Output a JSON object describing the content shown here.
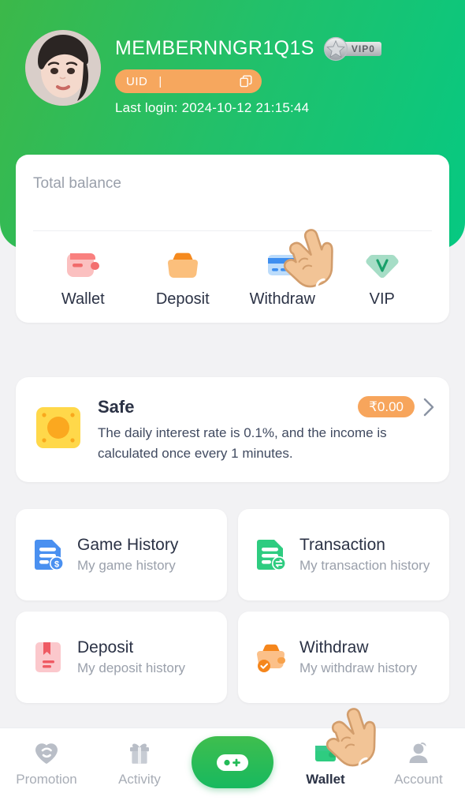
{
  "header": {
    "username": "MEMBERNNGR1Q1S",
    "vip_badge": "VIP0",
    "uid_label": "UID",
    "uid_separator": "|",
    "uid_value": "",
    "copy_icon": "copy-icon",
    "last_login": "Last login: 2024-10-12 21:15:44",
    "gradient_from": "#3cb849",
    "gradient_to": "#06c982"
  },
  "balance": {
    "label": "Total balance",
    "value": "",
    "actions": [
      {
        "label": "Wallet",
        "icon": "wallet-icon",
        "color": "#f9a6a6"
      },
      {
        "label": "Deposit",
        "icon": "deposit-icon",
        "color": "#f8ab5f"
      },
      {
        "label": "Withdraw",
        "icon": "withdraw-icon",
        "color": "#4a9cf0"
      },
      {
        "label": "VIP",
        "icon": "vip-gem-icon",
        "color": "#8fd9bd"
      }
    ]
  },
  "safe": {
    "icon": "safe-vault-icon",
    "title": "Safe",
    "amount": "₹0.00",
    "description": "The daily interest rate is 0.1%, and the income is calculated once every 1 minutes.",
    "chevron": "chevron-right-icon",
    "badge_color": "#f7a55c"
  },
  "history_cards": [
    {
      "title": "Game History",
      "subtitle": "My game history",
      "icon": "game-history-icon",
      "color": "#4a90f0"
    },
    {
      "title": "Transaction",
      "subtitle": "My transaction history",
      "icon": "transaction-icon",
      "color": "#2ecc80"
    },
    {
      "title": "Deposit",
      "subtitle": "My deposit history",
      "icon": "deposit-history-icon",
      "color": "#f2919a"
    },
    {
      "title": "Withdraw",
      "subtitle": "My withdraw history",
      "icon": "withdraw-history-icon",
      "color": "#f7a95e"
    }
  ],
  "bottom_nav": {
    "items": [
      {
        "label": "Promotion",
        "icon": "promotion-heart-icon",
        "active": false
      },
      {
        "label": "Activity",
        "icon": "gift-icon",
        "active": false
      },
      {
        "label": "Wallet",
        "icon": "wallet-nav-icon",
        "active": true
      },
      {
        "label": "Account",
        "icon": "account-person-icon",
        "active": false
      }
    ],
    "center_button": {
      "icon": "gamepad-icon",
      "color": "#23bb58"
    }
  },
  "cursors": [
    {
      "name": "pointing-hand-withdraw",
      "target": "Withdraw"
    },
    {
      "name": "pointing-hand-wallet",
      "target": "Wallet"
    }
  ]
}
